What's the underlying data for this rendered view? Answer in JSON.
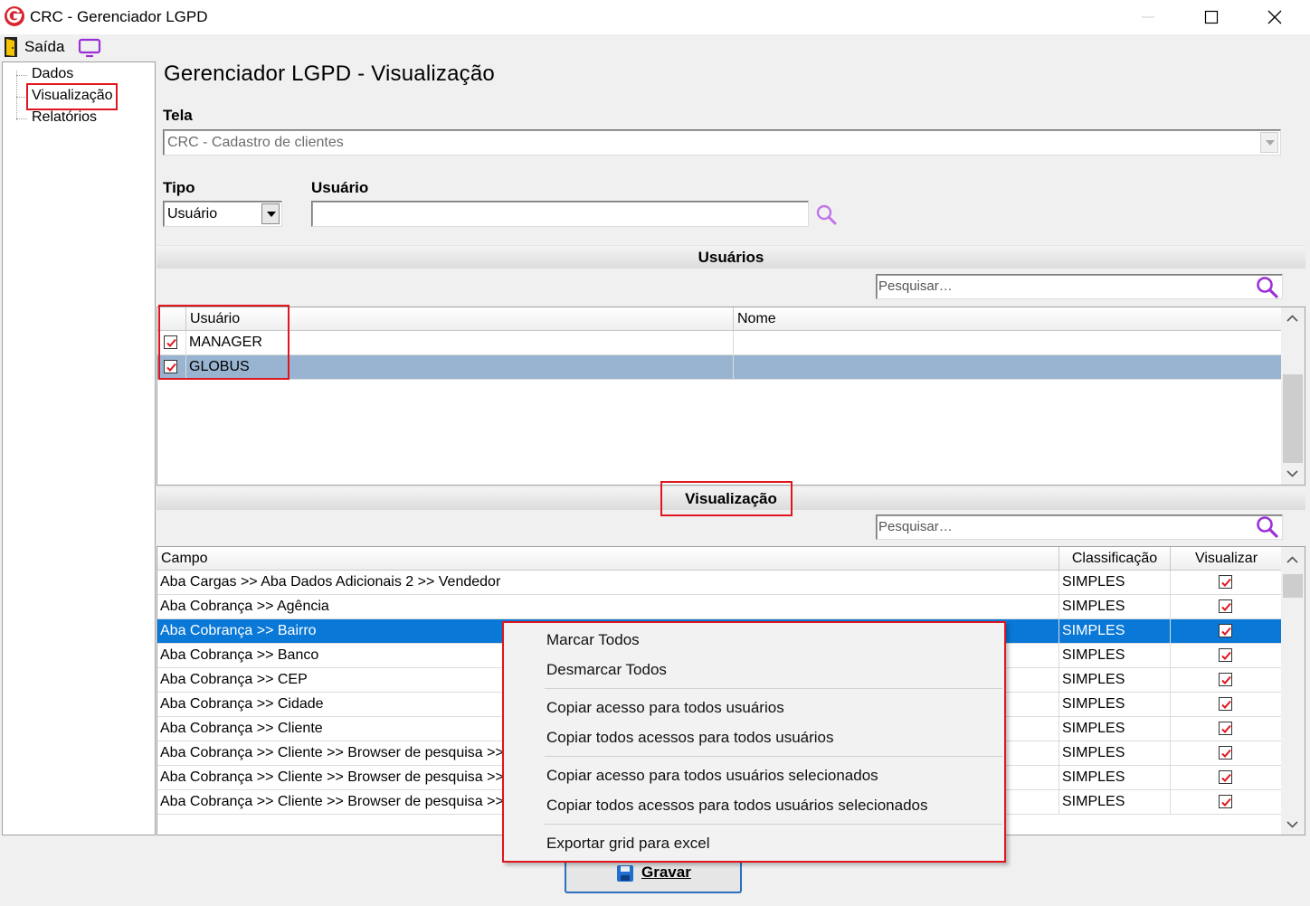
{
  "window": {
    "title": "CRC - Gerenciador LGPD"
  },
  "toolbar": {
    "exit_label": "Saída"
  },
  "nav": {
    "items": [
      {
        "label": "Dados"
      },
      {
        "label": "Visualização"
      },
      {
        "label": "Relatórios"
      }
    ],
    "selected": "Visualização"
  },
  "main": {
    "title": "Gerenciador LGPD - Visualização",
    "tela_label": "Tela",
    "tela_value": "CRC - Cadastro de clientes",
    "tipo_label": "Tipo",
    "tipo_value": "Usuário",
    "usuario_label": "Usuário",
    "usuario_value": ""
  },
  "users_section": {
    "title": "Usuários",
    "search_placeholder": "Pesquisar…",
    "columns": [
      "Usuário",
      "Nome"
    ],
    "rows": [
      {
        "checked": true,
        "usuario": "MANAGER",
        "nome": ""
      },
      {
        "checked": true,
        "usuario": "GLOBUS",
        "nome": ""
      }
    ]
  },
  "view_section": {
    "title": "Visualização",
    "search_placeholder": "Pesquisar…",
    "columns": [
      "Campo",
      "Classificação",
      "Visualizar"
    ],
    "rows": [
      {
        "campo": "Aba Cargas >> Aba Dados Adicionais 2 >> Vendedor",
        "classificacao": "SIMPLES",
        "visualizar": true
      },
      {
        "campo": "Aba Cobrança >> Agência",
        "classificacao": "SIMPLES",
        "visualizar": true
      },
      {
        "campo": "Aba Cobrança >> Bairro",
        "classificacao": "SIMPLES",
        "visualizar": true
      },
      {
        "campo": "Aba Cobrança >> Banco",
        "classificacao": "SIMPLES",
        "visualizar": true
      },
      {
        "campo": "Aba Cobrança >> CEP",
        "classificacao": "SIMPLES",
        "visualizar": true
      },
      {
        "campo": "Aba Cobrança >> Cidade",
        "classificacao": "SIMPLES",
        "visualizar": true
      },
      {
        "campo": "Aba Cobrança >> Cliente",
        "classificacao": "SIMPLES",
        "visualizar": true
      },
      {
        "campo": "Aba Cobrança >> Cliente >> Browser de pesquisa >>",
        "classificacao": "SIMPLES",
        "visualizar": true
      },
      {
        "campo": "Aba Cobrança >> Cliente >> Browser de pesquisa >>",
        "classificacao": "SIMPLES",
        "visualizar": true
      },
      {
        "campo": "Aba Cobrança >> Cliente >> Browser de pesquisa >>",
        "classificacao": "SIMPLES",
        "visualizar": true
      }
    ]
  },
  "context_menu": {
    "items": [
      "Marcar Todos",
      "Desmarcar Todos",
      "Copiar acesso para todos usuários",
      "Copiar todos acessos para todos usuários",
      "Copiar acesso para todos usuários selecionados",
      "Copiar todos acessos para todos usuários selecionados",
      "Exportar grid para excel"
    ]
  },
  "footer": {
    "save_label": "Gravar"
  },
  "colors": {
    "highlight_red": "#e0161e",
    "selection_blue": "#0a78d7",
    "selection_light": "#99b4d1",
    "search_icon": "#9b30d9",
    "logo_red": "#d8262e"
  }
}
